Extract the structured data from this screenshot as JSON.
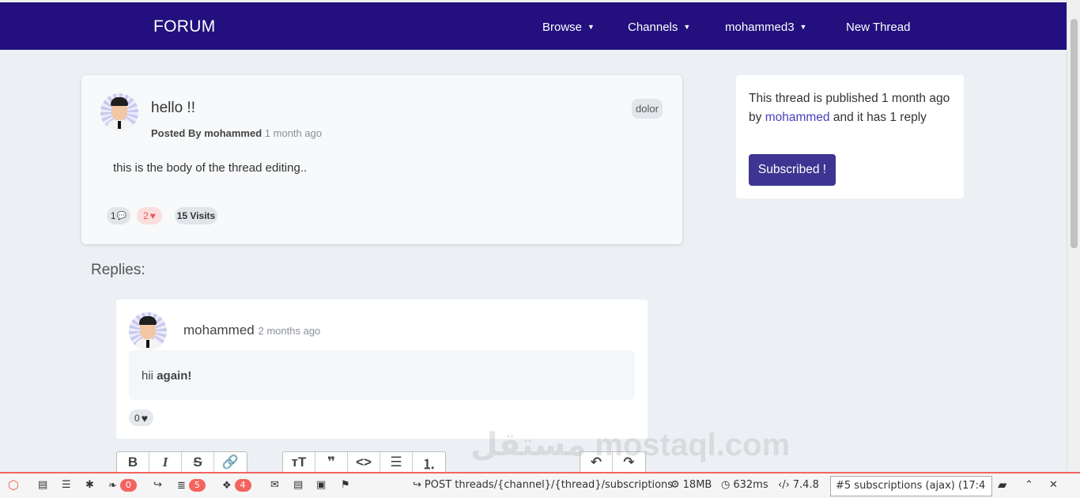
{
  "navbar": {
    "brand": "FORUM",
    "items": [
      {
        "label": "Browse"
      },
      {
        "label": "Channels"
      },
      {
        "label": "mohammed3"
      },
      {
        "label": "New Thread"
      }
    ]
  },
  "thread": {
    "title": "hello !!",
    "posted_by_label": "Posted By",
    "author": "mohammed",
    "time": "1 month ago",
    "channel_tag": "dolor",
    "body": "this is the body of the thread editing..",
    "replies_count": "1",
    "likes_count": "2",
    "visits": "15 Visits"
  },
  "info": {
    "text_before": "This thread is published 1 month ago by",
    "author_link": "mohammed",
    "text_after": "and it has 1 reply",
    "subscribe_label": "Subscribed !"
  },
  "replies": {
    "heading": "Replies:",
    "items": [
      {
        "author": "mohammed",
        "time": "2 months ago",
        "body_plain": "hii",
        "body_bold": "again!",
        "likes": "0"
      }
    ]
  },
  "editor_toolbar": {
    "group1": [
      "B",
      "I",
      "S",
      "🔗"
    ],
    "group2": [
      "ᴛT",
      "❞",
      "<>",
      "☰",
      "⒈",
      "⇤",
      "⇥"
    ],
    "group3": [
      "↶",
      "↷"
    ]
  },
  "watermark": "مستقل mostaql.com",
  "debugbar": {
    "messages_count": "0",
    "queries_count": "5",
    "models_count": "4",
    "route": "POST threads/{channel}/{thread}/subscriptions",
    "memory": "18MB",
    "time": "632ms",
    "php_version": "7.4.8",
    "request_select": "#5 subscriptions (ajax) (17:4"
  },
  "colors": {
    "navbar": "#23107e",
    "button": "#3d3591",
    "debug_accent": "#f4645f"
  }
}
